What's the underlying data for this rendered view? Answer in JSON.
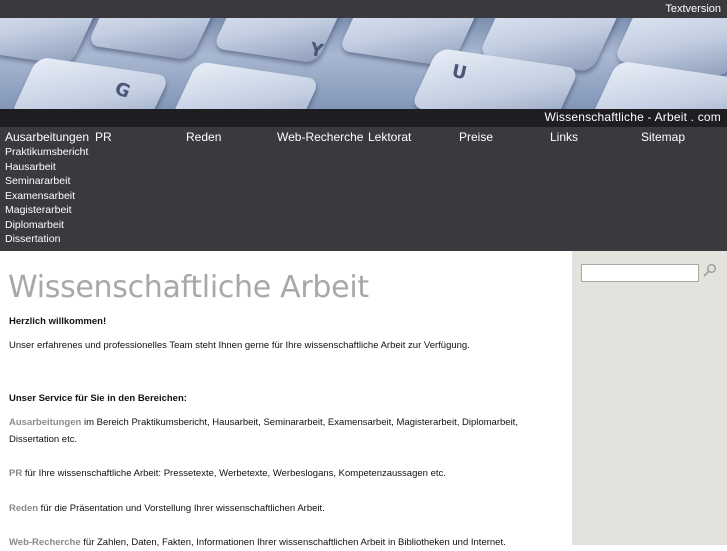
{
  "topbar": {
    "textversion": "Textversion"
  },
  "banner": {
    "keys": [
      "Y",
      "U",
      "G"
    ]
  },
  "site_title": "Wissenschaftliche - Arbeit . com",
  "nav": {
    "items": [
      "Ausarbeitungen",
      "PR",
      "Reden",
      "Web-Recherche",
      "Lektorat",
      "Preise",
      "Links",
      "Sitemap"
    ],
    "subitems": [
      "Praktikumsbericht",
      "Hausarbeit",
      "Seminararbeit",
      "Examensarbeit",
      "Magisterarbeit",
      "Diplomarbeit",
      "Dissertation"
    ]
  },
  "search": {
    "placeholder": "",
    "icon": "search-icon"
  },
  "main": {
    "title": "Wissenschaftliche Arbeit",
    "welcome": "Herzlich willkommen!",
    "intro": "Unser erfahrenes und professionelles Team steht Ihnen gerne für Ihre wissenschaftliche Arbeit zur Verfügung.",
    "service_heading": "Unser Service für Sie in den Bereichen:",
    "services": [
      {
        "link": "Ausarbeitungen",
        "text": " im Bereich Praktikumsbericht, Hausarbeit, Seminararbeit, Examensarbeit, Magisterarbeit, Diplomarbeit, Dissertation etc."
      },
      {
        "link": "PR",
        "text": " für Ihre wissenschaftliche Arbeit: Pressetexte, Werbetexte, Werbeslogans, Kompetenzaussagen etc."
      },
      {
        "link": "Reden",
        "text": " für die Präsentation und Vorstellung Ihrer wissenschaftlichen Arbeit."
      },
      {
        "link": "Web-Recherche",
        "text": " für Zahlen, Daten, Fakten, Informationen Ihrer wissenschaftlichen Arbeit in Bibliotheken und Internet."
      }
    ]
  },
  "colors": {
    "nav_bg": "#3a3a3e",
    "sidebar_bg": "#e3e2dc",
    "title": "#a8a8a8",
    "link": "#8a8a8a"
  }
}
